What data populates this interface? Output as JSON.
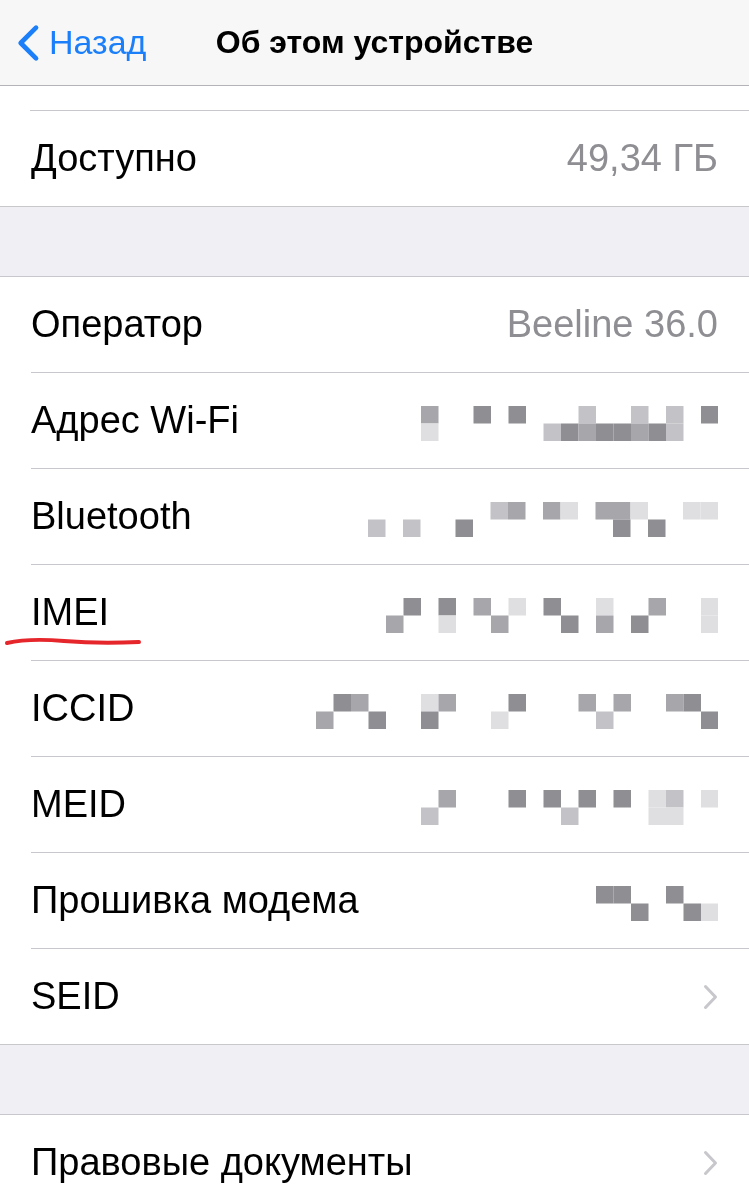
{
  "nav_bar": {
    "back_button": {
      "label": "Назад"
    },
    "title": "Об этом устройстве"
  },
  "groups": [
    {
      "clipped_top": true,
      "rows": [
        {
          "kind": "value",
          "label": "Доступно",
          "value": "49,34 ГБ",
          "underlined": false
        }
      ]
    },
    {
      "clipped_top": false,
      "rows": [
        {
          "kind": "value",
          "label": "Оператор",
          "value": "Beeline 36.0",
          "underlined": false
        },
        {
          "kind": "redacted",
          "label": "Адрес Wi-Fi",
          "underlined": false
        },
        {
          "kind": "redacted",
          "label": "Bluetooth",
          "underlined": false
        },
        {
          "kind": "redacted",
          "label": "IMEI",
          "underlined": true
        },
        {
          "kind": "redacted",
          "label": "ICCID",
          "underlined": false
        },
        {
          "kind": "redacted",
          "label": "MEID",
          "underlined": false
        },
        {
          "kind": "redacted",
          "label": "Прошивка модема",
          "underlined": false
        },
        {
          "kind": "link",
          "label": "SEID",
          "underlined": false
        }
      ]
    },
    {
      "clipped_top": false,
      "rows": [
        {
          "kind": "link",
          "label": "Правовые документы",
          "underlined": false
        }
      ]
    }
  ]
}
